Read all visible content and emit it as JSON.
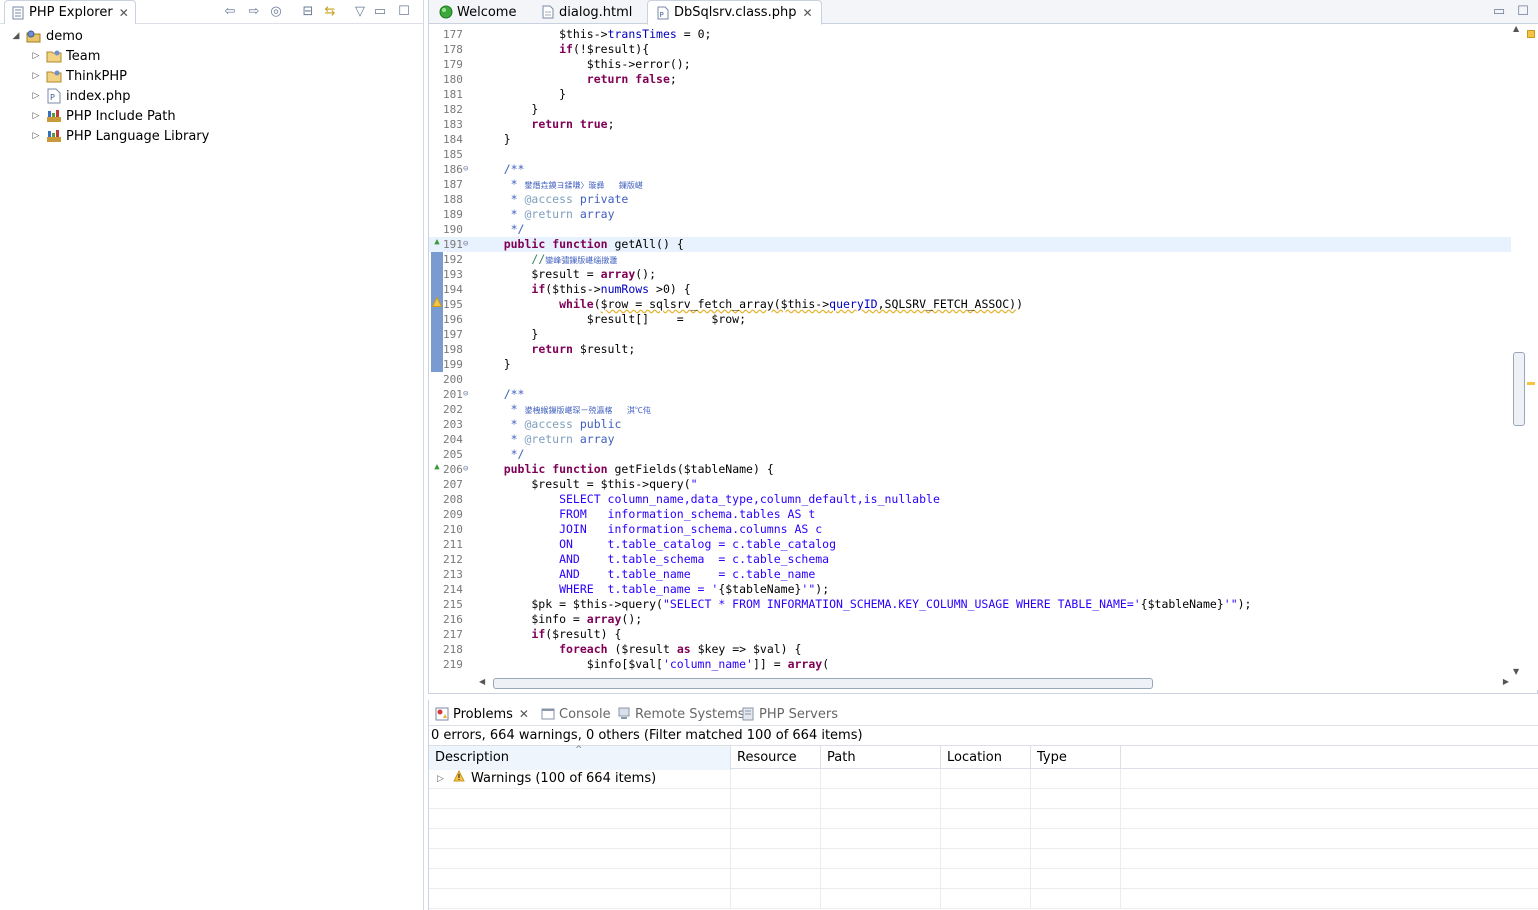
{
  "explorer": {
    "tab_label": "PHP Explorer",
    "tree": [
      {
        "label": "demo",
        "level": 0,
        "icon": "php-project-icon",
        "expanded": true
      },
      {
        "label": "Team",
        "level": 1,
        "icon": "folder-icon"
      },
      {
        "label": "ThinkPHP",
        "level": 1,
        "icon": "folder-icon"
      },
      {
        "label": "index.php",
        "level": 1,
        "icon": "php-file-icon"
      },
      {
        "label": "PHP Include Path",
        "level": 1,
        "icon": "library-icon"
      },
      {
        "label": "PHP Language Library",
        "level": 1,
        "icon": "library-icon"
      }
    ]
  },
  "editor": {
    "tabs": [
      {
        "label": "Welcome",
        "icon": "welcome-icon",
        "active": false
      },
      {
        "label": "dialog.html",
        "icon": "html-file-icon",
        "active": false
      },
      {
        "label": "DbSqlsrv.class.php",
        "icon": "php-file-icon",
        "active": true
      }
    ],
    "current_line": 191,
    "lines": [
      {
        "n": 177,
        "html": "            $this-><span class=\"prop\">transTimes</span> = 0;"
      },
      {
        "n": 178,
        "html": "            <span class=\"kw\">if</span>(!$result){"
      },
      {
        "n": 179,
        "html": "                $this->error();"
      },
      {
        "n": 180,
        "html": "                <span class=\"kw\">return</span> <span class=\"kw\">false</span>;"
      },
      {
        "n": 181,
        "html": "            }"
      },
      {
        "n": 182,
        "html": "        }"
      },
      {
        "n": 183,
        "html": "        <span class=\"kw\">return</span> <span class=\"kw\">true</span>;"
      },
      {
        "n": 184,
        "html": "    }"
      },
      {
        "n": 185,
        "html": ""
      },
      {
        "n": 186,
        "html": "    <span class=\"cmt\">/**</span>",
        "fold": true
      },
      {
        "n": 187,
        "html": "     <span class=\"cmt\">* </span><span class=\"cmt-zh\">鐢熸垚鏌ヨ鍒嗛〉璇彞   鏁版嵁</span>"
      },
      {
        "n": 188,
        "html": "     <span class=\"cmt\">* </span><span class=\"cmt-tag\">@access</span><span class=\"cmt\"> private</span>"
      },
      {
        "n": 189,
        "html": "     <span class=\"cmt\">* </span><span class=\"cmt-tag\">@return</span><span class=\"cmt\"> array</span>"
      },
      {
        "n": 190,
        "html": "     <span class=\"cmt\">*/</span>"
      },
      {
        "n": 191,
        "html": "    <span class=\"kw\">public</span> <span class=\"kw\">function</span> getAll() {",
        "fold": true,
        "gutter": "override"
      },
      {
        "n": 192,
        "html": "        <span class=\"sl-cmt\">//</span><span class=\"cmt-zh\">鑾峰彇鏁版嵁缁撴灉</span>"
      },
      {
        "n": 193,
        "html": "        $result = <span class=\"kw\">array</span>();"
      },
      {
        "n": 194,
        "html": "        <span class=\"kw\">if</span>($this-><span class=\"prop\">numRows</span> >0) {"
      },
      {
        "n": 195,
        "html": "            <span class=\"kw\">while</span>(<span class=\"warn-under\">$row = sqlsrv_fetch_array($this-><span class=\"prop\">queryID</span>,SQLSRV_FETCH_ASSOC)</span>)",
        "gutter": "warning"
      },
      {
        "n": 196,
        "html": "                $result[]    =    $row;"
      },
      {
        "n": 197,
        "html": "        }"
      },
      {
        "n": 198,
        "html": "        <span class=\"kw\">return</span> $result;"
      },
      {
        "n": 199,
        "html": "    }"
      },
      {
        "n": 200,
        "html": ""
      },
      {
        "n": 201,
        "html": "    <span class=\"cmt\">/**</span>",
        "fold": true
      },
      {
        "n": 202,
        "html": "     <span class=\"cmt\">* </span><span class=\"cmt-zh\">鍙栧緱鏁版嵁琛ㄧ殑瀛楁   淇℃伅</span>"
      },
      {
        "n": 203,
        "html": "     <span class=\"cmt\">* </span><span class=\"cmt-tag\">@access</span><span class=\"cmt\"> public</span>"
      },
      {
        "n": 204,
        "html": "     <span class=\"cmt\">* </span><span class=\"cmt-tag\">@return</span><span class=\"cmt\"> array</span>"
      },
      {
        "n": 205,
        "html": "     <span class=\"cmt\">*/</span>"
      },
      {
        "n": 206,
        "html": "    <span class=\"kw\">public</span> <span class=\"kw\">function</span> getFields($tableName) {",
        "fold": true,
        "gutter": "override"
      },
      {
        "n": 207,
        "html": "        $result = $this->query(<span class=\"str\">\"</span>"
      },
      {
        "n": 208,
        "html": "<span class=\"str\">            SELECT column_name,data_type,column_default,is_nullable</span>"
      },
      {
        "n": 209,
        "html": "<span class=\"str\">            FROM   information_schema.tables AS t</span>"
      },
      {
        "n": 210,
        "html": "<span class=\"str\">            JOIN   information_schema.columns AS c</span>"
      },
      {
        "n": 211,
        "html": "<span class=\"str\">            ON     t.table_catalog = c.table_catalog</span>"
      },
      {
        "n": 212,
        "html": "<span class=\"str\">            AND    t.table_schema  = c.table_schema</span>"
      },
      {
        "n": 213,
        "html": "<span class=\"str\">            AND    t.table_name    = c.table_name</span>"
      },
      {
        "n": 214,
        "html": "<span class=\"str\">            WHERE  t.table_name = '</span>{$tableName}<span class=\"str\">'\"</span>);"
      },
      {
        "n": 215,
        "html": "        $pk = $this->query(<span class=\"str\">\"SELECT * FROM INFORMATION_SCHEMA.KEY_COLUMN_USAGE WHERE TABLE_NAME='</span>{$tableName}<span class=\"str\">'\"</span>);"
      },
      {
        "n": 216,
        "html": "        $info = <span class=\"kw\">array</span>();"
      },
      {
        "n": 217,
        "html": "        <span class=\"kw\">if</span>($result) {"
      },
      {
        "n": 218,
        "html": "            <span class=\"kw\">foreach</span> ($result <span class=\"kw\">as</span> $key => $val) {"
      },
      {
        "n": 219,
        "html": "                $info[$val[<span class=\"str\">'column_name'</span>]] = <span class=\"kw\">array</span>("
      }
    ]
  },
  "problems": {
    "tabs": [
      {
        "label": "Problems",
        "icon": "problems-icon",
        "active": true
      },
      {
        "label": "Console",
        "icon": "console-icon",
        "active": false
      },
      {
        "label": "Remote Systems",
        "icon": "remote-systems-icon",
        "active": false
      },
      {
        "label": "PHP Servers",
        "icon": "php-servers-icon",
        "active": false
      }
    ],
    "summary": "0 errors, 664 warnings, 0 others (Filter matched 100 of 664 items)",
    "columns": [
      "Description",
      "Resource",
      "Path",
      "Location",
      "Type"
    ],
    "rows": [
      {
        "description": "Warnings (100 of 664 items)",
        "resource": "",
        "path": "",
        "location": "",
        "type": ""
      }
    ]
  },
  "colors": {
    "keyword": "#7f0055",
    "string": "#2a00ff",
    "javadoc": "#3f5fbf",
    "current_line": "#e8f2fe",
    "change_bar": "#7a9bd0"
  }
}
